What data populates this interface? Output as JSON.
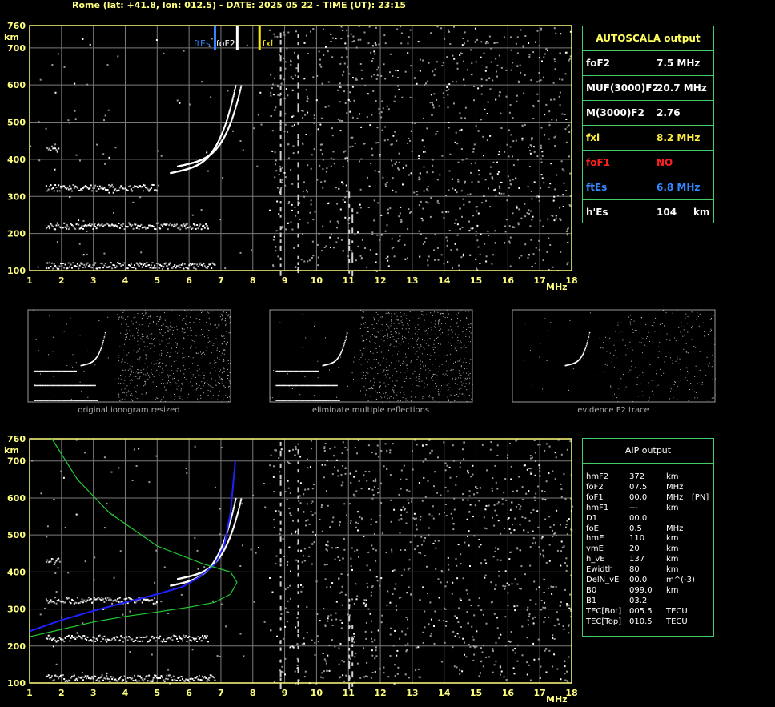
{
  "header": {
    "title": "Rome (lat: +41.8, lon: 012.5) - DATE: 2025 05 22 - TIME (UT): 23:15"
  },
  "colors": {
    "frame": "#ffff80",
    "grid": "#808080",
    "green": "#22cc33",
    "blue": "#2020ff",
    "ftes": "#3388ff",
    "fxl": "#ffee00",
    "red": "#ff2020",
    "table_border": "#44cc66"
  },
  "autoscala": {
    "title": "AUTOSCALA output",
    "rows": [
      {
        "label": "foF2",
        "value": "7.5 MHz",
        "color": "#ffffff"
      },
      {
        "label": "MUF(3000)F2",
        "value": "20.7 MHz",
        "color": "#ffffff"
      },
      {
        "label": "M(3000)F2",
        "value": "2.76",
        "color": "#ffffff"
      },
      {
        "label": "fxl",
        "value": "8.2 MHz",
        "color": "#ffee40"
      },
      {
        "label": "foF1",
        "value": "NO",
        "color": "#ff2020"
      },
      {
        "label": "ftEs",
        "value": "6.8 MHz",
        "color": "#3388ff"
      },
      {
        "label": "h'Es",
        "value": "104     km",
        "color": "#ffffff"
      }
    ]
  },
  "aip": {
    "title": "AIP output",
    "rows": [
      [
        "hmF2",
        "372",
        "km",
        ""
      ],
      [
        "foF2",
        "07.5",
        "MHz",
        ""
      ],
      [
        "foF1",
        "00.0",
        "MHz",
        "[PN]"
      ],
      [
        "hmF1",
        "---",
        "km",
        ""
      ],
      [
        "D1",
        "00.0",
        "",
        ""
      ],
      [
        "foE",
        "0.5",
        "MHz",
        ""
      ],
      [
        "hmE",
        "110",
        "km",
        ""
      ],
      [
        "ymE",
        "20",
        "km",
        ""
      ],
      [
        "h_vE",
        "137",
        "km",
        ""
      ],
      [
        "Ewidth",
        "80",
        "km",
        ""
      ],
      [
        "DelN_vE",
        "00.0",
        "m^(-3)",
        ""
      ],
      [
        "B0",
        "099.0",
        "km",
        ""
      ],
      [
        "B1",
        "03.2",
        "",
        ""
      ],
      [
        "TEC[Bot]",
        "005.5",
        "TECU",
        ""
      ],
      [
        "TEC[Top]",
        "010.5",
        "TECU",
        ""
      ]
    ]
  },
  "thumbnails": {
    "captions": [
      "original ionogram resized",
      "eliminate multiple reflections",
      "evidence F2 trace"
    ]
  },
  "chart_data": [
    {
      "type": "scatter",
      "title": "",
      "xlabel": "MHz",
      "ylabel": "km",
      "xlim": [
        1,
        18
      ],
      "ylim": [
        100,
        760
      ],
      "grid": true,
      "x_ticks": [
        "1",
        "2",
        "3",
        "4",
        "5",
        "6",
        "7",
        "8",
        "9",
        "10",
        "11",
        "12",
        "13",
        "14",
        "15",
        "16",
        "17",
        "18"
      ],
      "y_ticks": [
        "100",
        "200",
        "300",
        "400",
        "500",
        "600",
        "700",
        "760"
      ],
      "markers": [
        {
          "name": "ftEs",
          "x": 6.8,
          "color": "#3388ff"
        },
        {
          "name": "foF2",
          "x": 7.5,
          "color": "#ffffff"
        },
        {
          "name": "fxl",
          "x": 8.2,
          "color": "#ffee00"
        }
      ],
      "traces": [
        {
          "name": "Es",
          "x_start": 1.5,
          "x_end": 6.8,
          "height": 115
        },
        {
          "name": "Es 2nd",
          "x_start": 1.5,
          "x_end": 6.6,
          "height": 222
        },
        {
          "name": "Es 3rd",
          "x_start": 1.5,
          "x_end": 5.0,
          "height": 325
        },
        {
          "name": "Es 4th",
          "x_start": 1.5,
          "x_end": 1.9,
          "height": 430
        }
      ]
    },
    {
      "type": "line",
      "title": "",
      "xlabel": "MHz",
      "ylabel": "km",
      "xlim": [
        1,
        18
      ],
      "ylim": [
        100,
        760
      ],
      "grid": true,
      "x_ticks": [
        "1",
        "2",
        "3",
        "4",
        "5",
        "6",
        "7",
        "8",
        "9",
        "10",
        "11",
        "12",
        "13",
        "14",
        "15",
        "16",
        "17",
        "18"
      ],
      "y_ticks": [
        "100",
        "200",
        "300",
        "400",
        "500",
        "600",
        "700",
        "760"
      ],
      "series": [
        {
          "color": "#2020ff",
          "x": [
            1.0,
            2.0,
            3.0,
            4.0,
            5.0,
            5.8,
            6.3,
            6.8,
            7.1,
            7.3,
            7.45
          ],
          "y": [
            240,
            270,
            295,
            318,
            340,
            360,
            385,
            420,
            470,
            560,
            700
          ]
        },
        {
          "color": "#22cc33",
          "x": [
            1.0,
            2.0,
            3.0,
            4.0,
            5.0,
            6.0,
            6.8,
            7.3,
            7.5,
            7.3,
            6.5,
            5.0,
            3.5,
            2.5,
            1.7
          ],
          "y": [
            225,
            245,
            265,
            280,
            292,
            305,
            318,
            340,
            372,
            400,
            420,
            470,
            560,
            650,
            760
          ]
        }
      ]
    }
  ]
}
